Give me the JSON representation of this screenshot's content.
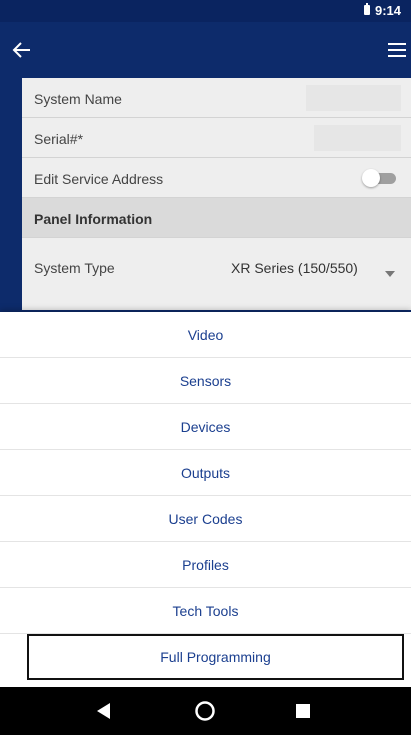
{
  "status_bar": {
    "time": "9:14"
  },
  "app_bar": {
    "back_icon": "arrow-left-icon",
    "menu_icon": "hamburger-menu-icon"
  },
  "form": {
    "system_name_label": "System Name",
    "serial_label": "Serial#*",
    "edit_service_address_label": "Edit Service Address",
    "edit_service_address_on": false,
    "panel_info_header": "Panel Information",
    "system_type_label": "System Type",
    "system_type_value": "XR Series (150/550)"
  },
  "menu": {
    "items": [
      {
        "label": "Video"
      },
      {
        "label": "Sensors"
      },
      {
        "label": "Devices"
      },
      {
        "label": "Outputs"
      },
      {
        "label": "User Codes"
      },
      {
        "label": "Profiles"
      },
      {
        "label": "Tech Tools"
      },
      {
        "label": "Full Programming",
        "selected": true
      }
    ]
  },
  "nav_bar": {
    "back": "triangle-back-icon",
    "home": "circle-home-icon",
    "recents": "square-recents-icon"
  },
  "colors": {
    "brand_blue": "#0d2b6b",
    "menu_text": "#1b3f8f",
    "panel_bg": "#eeeeee"
  }
}
